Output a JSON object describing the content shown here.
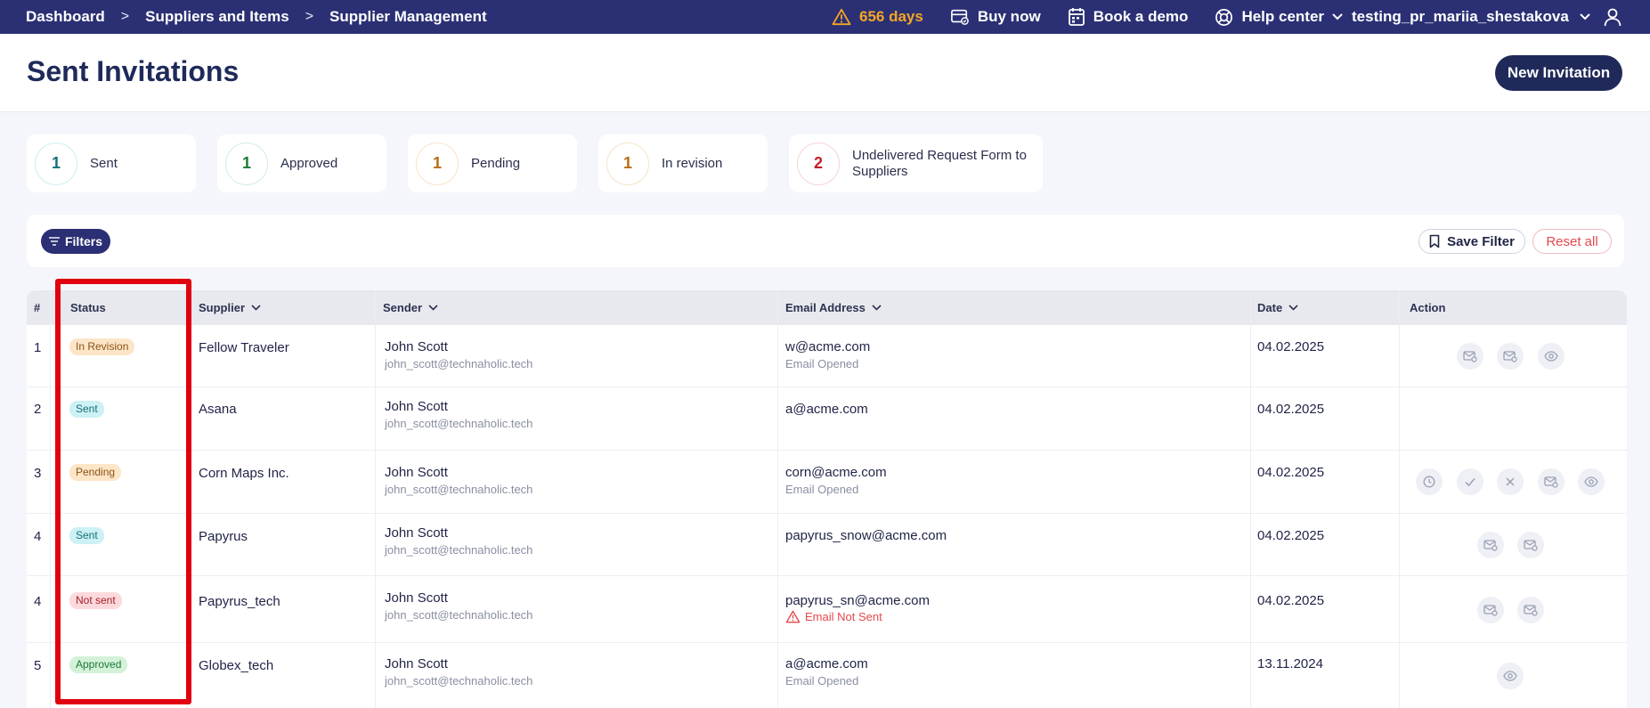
{
  "topbar": {
    "breadcrumb": [
      "Dashboard",
      "Suppliers and Items",
      "Supplier Management"
    ],
    "trial": "656 days",
    "buy_now": "Buy now",
    "book_demo": "Book a demo",
    "help_center": "Help center",
    "username": "testing_pr_mariia_shestakova",
    "colors": {
      "background": "#2b3074",
      "warning": "#f5a623"
    }
  },
  "header": {
    "title": "Sent Invitations",
    "new_button": "New Invitation"
  },
  "stats": [
    {
      "count": "1",
      "label": "Sent",
      "color": "#16707a"
    },
    {
      "count": "1",
      "label": "Approved",
      "color": "#1d7a35"
    },
    {
      "count": "1",
      "label": "Pending",
      "color": "#b76e12"
    },
    {
      "count": "1",
      "label": "In revision",
      "color": "#b76e12"
    },
    {
      "count": "2",
      "label": "Undelivered Request Form to Suppliers",
      "color": "#c0202c"
    }
  ],
  "filterbar": {
    "filters": "Filters",
    "save_filter": "Save Filter",
    "reset_all": "Reset all"
  },
  "table": {
    "columns": [
      "#",
      "Status",
      "Supplier",
      "Sender",
      "Email Address",
      "Date",
      "Action"
    ],
    "rows": [
      {
        "num": "1",
        "status": "In Revision",
        "supplier": "Fellow Traveler",
        "sender": "John Scott",
        "sender_email": "john_scott@technaholic.tech",
        "email": "w@acme.com",
        "email_status": "Email Opened",
        "date": "04.02.2025",
        "actions": [
          "mail-settings-icon",
          "mail-settings-icon",
          "eye-icon"
        ]
      },
      {
        "num": "2",
        "status": "Sent",
        "supplier": "Asana",
        "sender": "John Scott",
        "sender_email": "john_scott@technaholic.tech",
        "email": "a@acme.com",
        "email_status": "",
        "date": "04.02.2025",
        "actions": []
      },
      {
        "num": "3",
        "status": "Pending",
        "supplier": "Corn Maps Inc.",
        "sender": "John Scott",
        "sender_email": "john_scott@technaholic.tech",
        "email": "corn@acme.com",
        "email_status": "Email Opened",
        "date": "04.02.2025",
        "actions": [
          "clock-icon",
          "check-icon",
          "x-icon",
          "mail-settings-icon",
          "eye-icon"
        ]
      },
      {
        "num": "4",
        "status": "Sent",
        "supplier": "Papyrus",
        "sender": "John Scott",
        "sender_email": "john_scott@technaholic.tech",
        "email": "papyrus_snow@acme.com",
        "email_status": "",
        "date": "04.02.2025",
        "actions": [
          "mail-settings-icon",
          "mail-settings-icon"
        ]
      },
      {
        "num": "4",
        "status": "Not sent",
        "supplier": "Papyrus_tech",
        "sender": "John Scott",
        "sender_email": "john_scott@technaholic.tech",
        "email": "papyrus_sn@acme.com",
        "email_status": "Email Not Sent",
        "date": "04.02.2025",
        "actions": [
          "mail-settings-icon",
          "mail-settings-icon"
        ]
      },
      {
        "num": "5",
        "status": "Approved",
        "supplier": "Globex_tech",
        "sender": "John Scott",
        "sender_email": "john_scott@technaholic.tech",
        "email": "a@acme.com",
        "email_status": "Email Opened",
        "date": "13.11.2024",
        "actions": [
          "eye-icon"
        ]
      }
    ]
  },
  "highlight": {
    "color": "#e0000f",
    "target": "Status"
  }
}
